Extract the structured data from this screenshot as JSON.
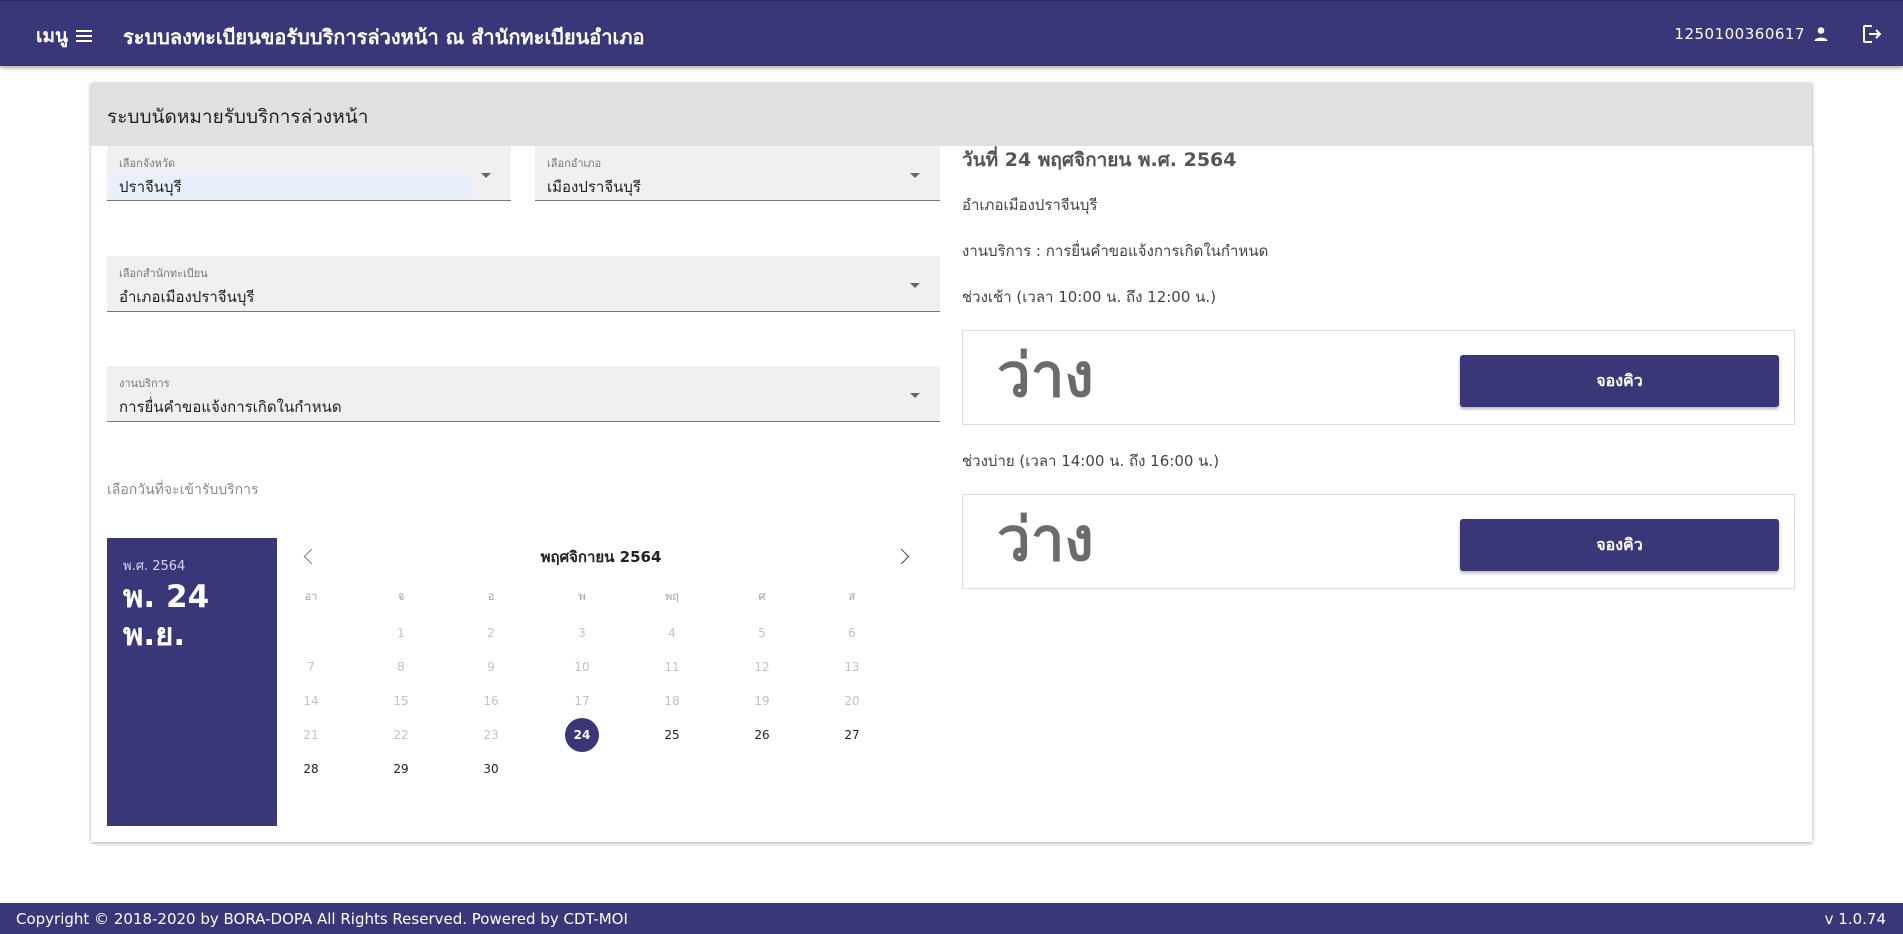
{
  "header": {
    "menu_label": "เมนู",
    "title": "ระบบลงทะเบียนขอรับบริการล่วงหน้า ณ สำนักทะเบียนอำเภอ",
    "user_id": "1250100360617",
    "icons": [
      "menu-icon",
      "person-icon",
      "logout-icon"
    ]
  },
  "card": {
    "title": "ระบบนัดหมายรับบริการล่วงหน้า"
  },
  "form": {
    "province": {
      "label": "เลือกจังหวัด",
      "value": "ปราจีนบุรี"
    },
    "district": {
      "label": "เลือกอำเภอ",
      "value": "เมืองปราจีนบุรี"
    },
    "office": {
      "label": "เลือกสำนักทะเบียน",
      "value": "อำเภอเมืองปราจีนบุรี"
    },
    "service": {
      "label": "งานบริการ",
      "value": "การยื่นคำขอแจ้งการเกิดในกำหนด"
    },
    "date_prompt": "เลือกวันที่จะเข้ารับบริการ"
  },
  "datepicker": {
    "year_label": "พ.ศ. 2564",
    "selected_line1": "พ. 24",
    "selected_line2": "พ.ย.",
    "month_title": "พฤศจิกายน 2564",
    "weekdays": [
      "อา",
      "จ",
      "อ",
      "พ",
      "พฤ",
      "ศ",
      "ส"
    ],
    "first_weekday_index": 1,
    "days_in_month": 30,
    "selected_day": 24,
    "enabled_from": 24
  },
  "details": {
    "date_heading": "วันที่ 24 พฤศจิกายน พ.ศ. 2564",
    "office_name": "อำเภอเมืองปราจีนบุรี",
    "service_line": "งานบริการ : การยื่นคำขอแจ้งการเกิดในกำหนด",
    "morning": {
      "label": "ช่วงเช้า (เวลา 10:00 น. ถึง 12:00 น.)",
      "status": "ว่าง",
      "button": "จองคิว"
    },
    "afternoon": {
      "label": "ช่วงบ่าย (เวลา 14:00 น. ถึง 16:00 น.)",
      "status": "ว่าง",
      "button": "จองคิว"
    }
  },
  "footer": {
    "copyright": "Copyright © 2018-2020 by BORA-DOPA All Rights Reserved. Powered by CDT-MOI",
    "version": "v 1.0.74"
  },
  "colors": {
    "primary": "#393778",
    "header_bg": "#e0e0e0",
    "field_bg": "#f0f0f0",
    "autofill_highlight": "#e8f0fe"
  }
}
